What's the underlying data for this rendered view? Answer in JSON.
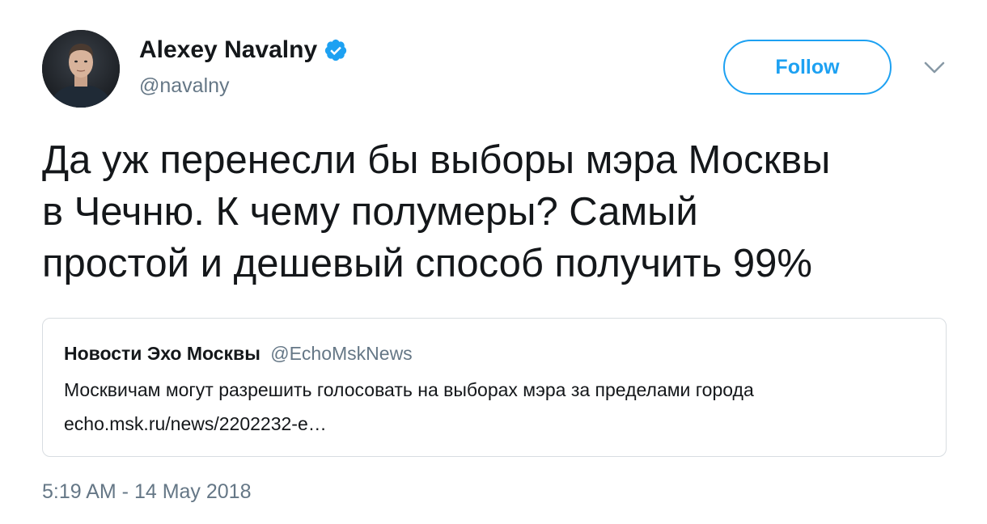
{
  "author": {
    "display_name": "Alexey Navalny",
    "username": "@navalny",
    "verified_icon": "verified-badge-icon"
  },
  "follow_button": {
    "label": "Follow"
  },
  "menu": {
    "icon": "chevron-down-icon"
  },
  "tweet": {
    "lines": [
      "Да уж перенесли бы выборы мэра Москвы",
      "в Чечню. К чему полумеры? Самый",
      "простой и дешевый способ получить 99%"
    ]
  },
  "quoted_tweet": {
    "display_name": "Новости Эхо Москвы",
    "username": "@EchoMskNews",
    "text": "Москвичам могут разрешить голосовать на выборах мэра за пределами города",
    "link": "echo.msk.ru/news/2202232-e…"
  },
  "timestamp": "5:19 AM - 14 May 2018",
  "colors": {
    "accent": "#1da1f2",
    "secondary_text": "#657786",
    "primary_text": "#14171a",
    "border": "#d8dde1"
  }
}
